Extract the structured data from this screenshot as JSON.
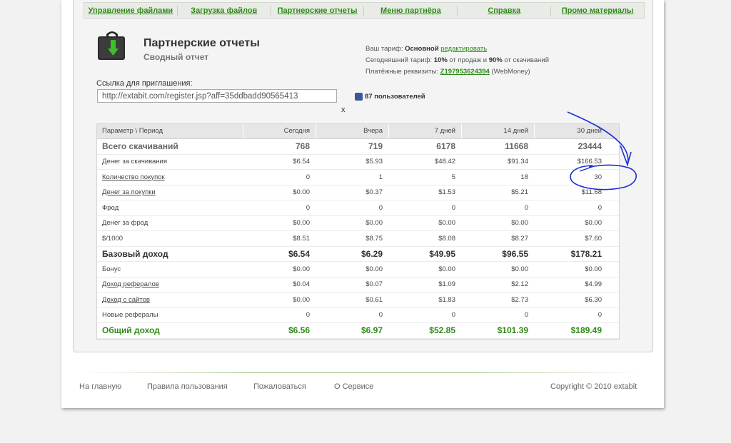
{
  "nav": {
    "items": [
      "Управление файлами",
      "Загрузка файлов",
      "Партнерские отчеты",
      "Меню партнёра",
      "Справка",
      "Промо материалы"
    ]
  },
  "header": {
    "title": "Партнерские отчеты",
    "subtitle": "Сводный отчет"
  },
  "tariff": {
    "plan_label": "Ваш тариф:",
    "plan_value": "Основной",
    "edit_link": "редактировать",
    "today_label": "Сегодняшний тариф:",
    "today_sales_pct": "10%",
    "today_mid": "от продаж и",
    "today_downloads_pct": "90%",
    "today_end": "от скачиваний",
    "payment_label": "Платёжные реквизиты:",
    "payment_wallet": "Z197953624394",
    "payment_system": "(WebMoney)"
  },
  "invite": {
    "label": "Ссылка для приглашения:",
    "url": "http://extabit.com/register.jsp?aff=35ddbadd90565413",
    "close": "x",
    "fb_count": "87 пользователей"
  },
  "table": {
    "columns": [
      "Параметр \\ Период",
      "Сегодня",
      "Вчера",
      "7 дней",
      "14 дней",
      "30 дней"
    ],
    "rows": [
      {
        "label": "Всего скачиваний",
        "style": "big gray",
        "link": false,
        "values": [
          "768",
          "719",
          "6178",
          "11668",
          "23444"
        ]
      },
      {
        "label": "Денег за скачивания",
        "style": "",
        "link": false,
        "values": [
          "$6.54",
          "$5.93",
          "$48.42",
          "$91.34",
          "$166.53"
        ]
      },
      {
        "label": "Количество покупок",
        "style": "",
        "link": true,
        "values": [
          "0",
          "1",
          "5",
          "18",
          "30"
        ]
      },
      {
        "label": "Денег за покупки",
        "style": "",
        "link": true,
        "values": [
          "$0.00",
          "$0.37",
          "$1.53",
          "$5.21",
          "$11.68"
        ]
      },
      {
        "label": "Фрод",
        "style": "",
        "link": false,
        "values": [
          "0",
          "0",
          "0",
          "0",
          "0"
        ]
      },
      {
        "label": "Денег за фрод",
        "style": "",
        "link": false,
        "values": [
          "$0.00",
          "$0.00",
          "$0.00",
          "$0.00",
          "$0.00"
        ]
      },
      {
        "label": "$/1000",
        "style": "",
        "link": false,
        "values": [
          "$8.51",
          "$8.75",
          "$8.08",
          "$8.27",
          "$7.60"
        ]
      },
      {
        "label": "Базовый доход",
        "style": "big",
        "link": false,
        "values": [
          "$6.54",
          "$6.29",
          "$49.95",
          "$96.55",
          "$178.21"
        ]
      },
      {
        "label": "Бонус",
        "style": "",
        "link": false,
        "values": [
          "$0.00",
          "$0.00",
          "$0.00",
          "$0.00",
          "$0.00"
        ]
      },
      {
        "label": "Доход рефералов",
        "style": "",
        "link": true,
        "values": [
          "$0.04",
          "$0.07",
          "$1.09",
          "$2.12",
          "$4.99"
        ]
      },
      {
        "label": "Доход с сайтов",
        "style": "",
        "link": true,
        "values": [
          "$0.00",
          "$0.61",
          "$1.83",
          "$2.73",
          "$6.30"
        ]
      },
      {
        "label": "Новые рефералы",
        "style": "",
        "link": false,
        "values": [
          "0",
          "0",
          "0",
          "0",
          "0"
        ]
      },
      {
        "label": "Общий доход",
        "style": "big green",
        "link": false,
        "values": [
          "$6.56",
          "$6.97",
          "$52.85",
          "$101.39",
          "$189.49"
        ]
      }
    ]
  },
  "footer": {
    "links": [
      "На главную",
      "Правила пользования",
      "Пожаловаться",
      "О Сервисе"
    ],
    "copyright": "Copyright © 2010 extabit"
  },
  "colors": {
    "accent_green": "#2f8a19",
    "annotation_blue": "#1a2fd6"
  }
}
